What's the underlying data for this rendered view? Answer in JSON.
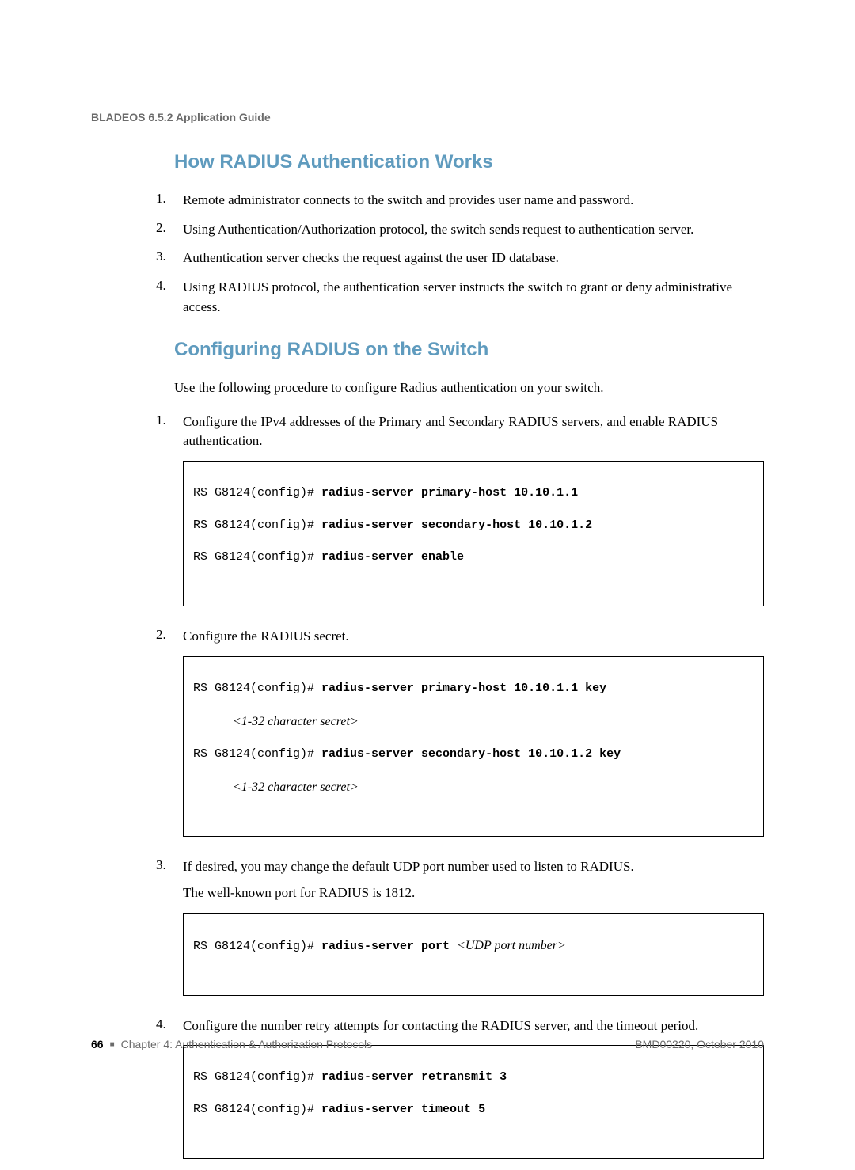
{
  "doc_header": "BLADEOS 6.5.2 Application Guide",
  "section1": {
    "heading": "How RADIUS Authentication Works",
    "steps": [
      "Remote administrator connects to the switch and provides user name and password.",
      "Using Authentication/Authorization protocol, the switch sends request to authentication server.",
      "Authentication server checks the request against the user ID database.",
      "Using RADIUS protocol, the authentication server instructs the switch to grant or deny administrative access."
    ]
  },
  "section2": {
    "heading": "Configuring RADIUS on the Switch",
    "intro": "Use the following procedure to configure Radius authentication on your switch.",
    "steps": [
      {
        "text": "Configure the IPv4 addresses of the Primary and Secondary RADIUS servers, and enable RADIUS authentication.",
        "code": [
          {
            "prompt": "RS G8124(config)# ",
            "bold": "radius-server primary-host 10.10.1.1"
          },
          {
            "prompt": "RS G8124(config)# ",
            "bold": "radius-server secondary-host 10.10.1.2"
          },
          {
            "prompt": "RS G8124(config)# ",
            "bold": "radius-server enable"
          }
        ]
      },
      {
        "text": "Configure the RADIUS secret.",
        "code": [
          {
            "prompt": "RS G8124(config)# ",
            "bold": "radius-server primary-host 10.10.1.1 key"
          },
          {
            "indent_italic": "<1-32 character secret>"
          },
          {
            "prompt": "RS G8124(config)# ",
            "bold": "radius-server secondary-host 10.10.1.2 key"
          },
          {
            "indent_italic": "<1-32 character secret>"
          }
        ]
      },
      {
        "text": "If desired, you may change the default UDP port number used to listen to RADIUS.",
        "note": "The well-known port for RADIUS is 1812.",
        "code": [
          {
            "prompt": "RS G8124(config)# ",
            "bold": "radius-server port ",
            "italic_tail": "<UDP port number>"
          }
        ]
      },
      {
        "text": "Configure the number retry attempts for contacting the RADIUS server, and the timeout period.",
        "code": [
          {
            "prompt": "RS G8124(config)# ",
            "bold": "radius-server retransmit 3"
          },
          {
            "prompt": "RS G8124(config)# ",
            "bold": "radius-server timeout 5"
          }
        ]
      }
    ]
  },
  "footer": {
    "page_number": "66",
    "chapter": "Chapter 4: Authentication & Authorization Protocols",
    "doc_id": "BMD00220, October 2010"
  }
}
